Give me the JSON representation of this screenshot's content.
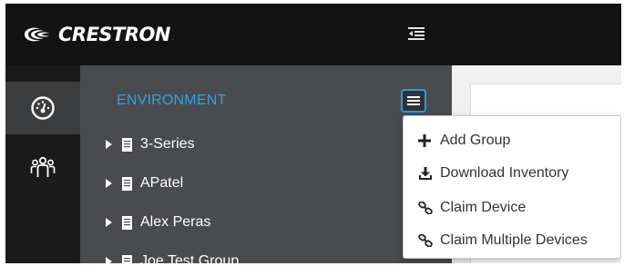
{
  "header": {
    "brand": "CRESTRON",
    "brand_mark": ".",
    "collapse_icon": "sidebar-collapse-icon"
  },
  "rail": {
    "items": [
      {
        "icon": "dashboard-gauge-icon",
        "active": true
      },
      {
        "icon": "users-group-icon",
        "active": false
      }
    ]
  },
  "tree": {
    "title": "ENVIRONMENT",
    "menu_icon": "hamburger-menu-icon",
    "groups": [
      {
        "label": "3-Series"
      },
      {
        "label": "APatel"
      },
      {
        "label": "Alex Peras"
      },
      {
        "label": "Joe Test Group"
      }
    ]
  },
  "dropdown": {
    "items": [
      {
        "icon": "plus-icon",
        "label": "Add Group"
      },
      {
        "icon": "download-icon",
        "label": "Download Inventory"
      },
      {
        "icon": "link-icon",
        "label": "Claim Device"
      },
      {
        "icon": "link-icon",
        "label": "Claim Multiple Devices"
      }
    ]
  },
  "colors": {
    "header_bg": "#131313",
    "rail_bg": "#1b1b1b",
    "tree_bg": "#494b4e",
    "accent": "#2aa4e3"
  }
}
